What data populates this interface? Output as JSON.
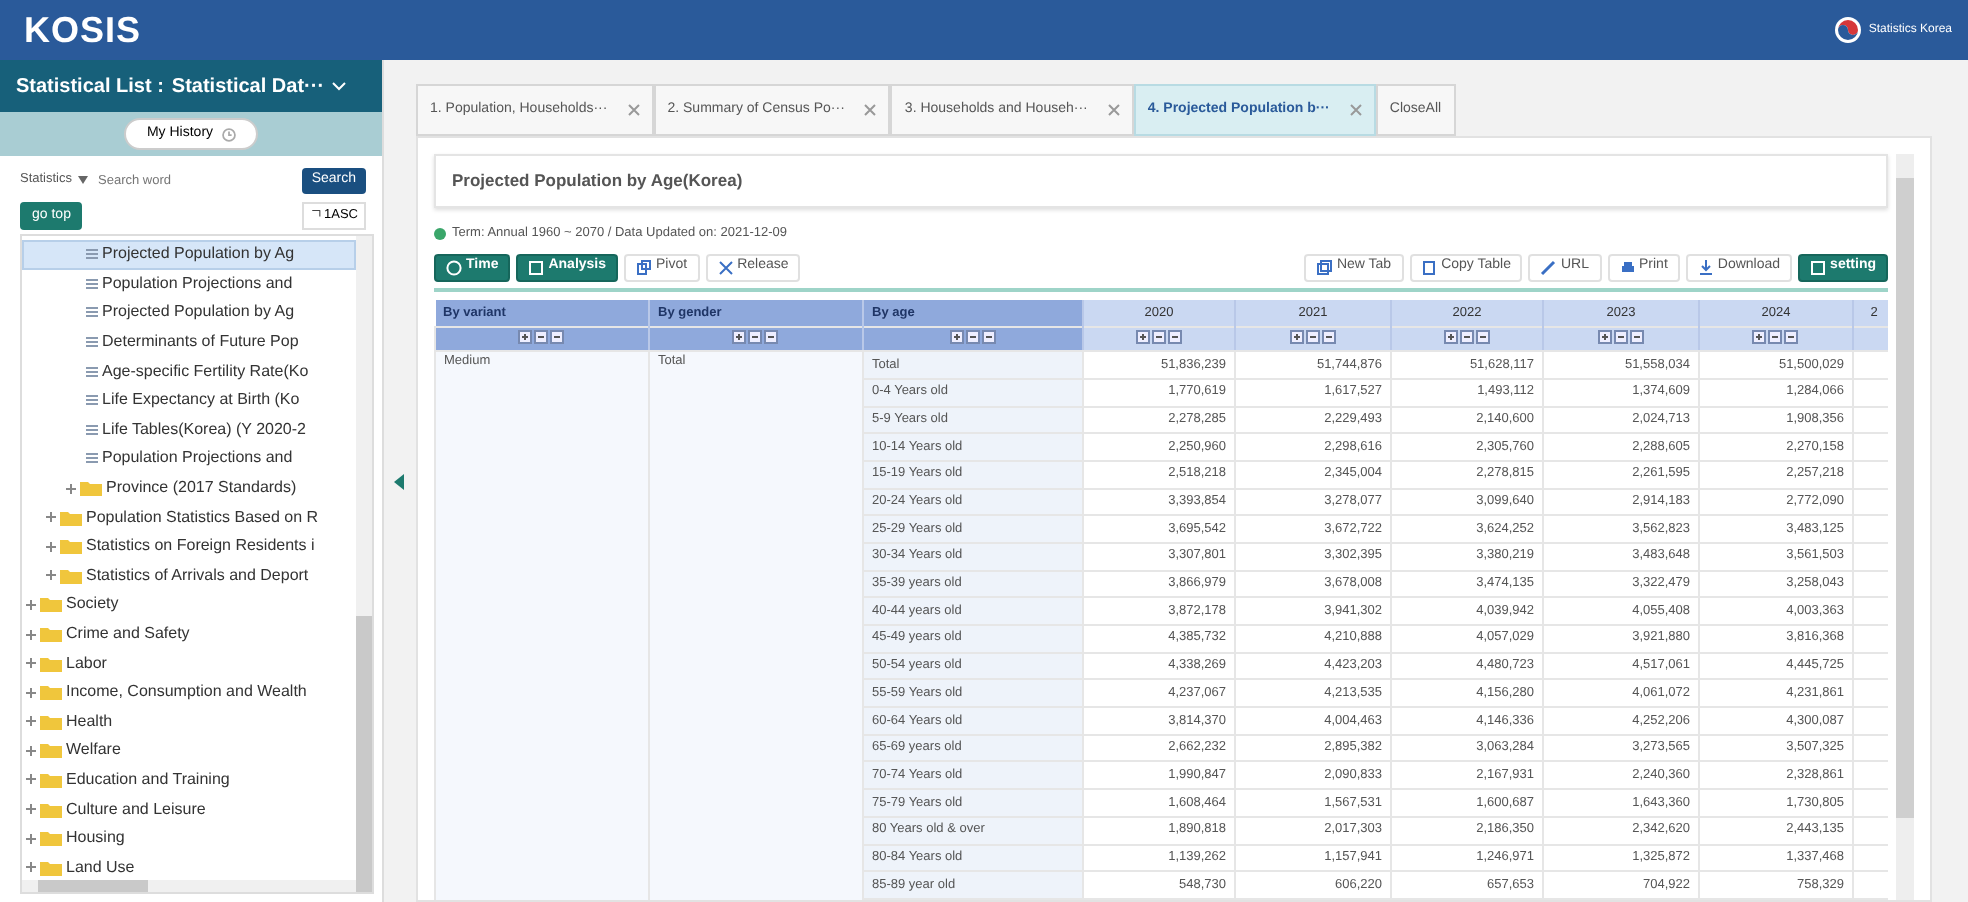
{
  "header": {
    "logo": "KOSIS",
    "org": "Statistics Korea"
  },
  "sidebar": {
    "list_title": "Statistical List :",
    "list_value": "Statistical Dat···",
    "history_button": "My History",
    "search_scope": "Statistics",
    "search_placeholder": "Search word",
    "search_button": "Search",
    "go_top_button": "go top",
    "sort_button": "ㄱ1ASC",
    "tree": [
      {
        "children": [
          {
            "children": [
              {
                "children": [
                  {
                    "label": "Projected Population by Ag",
                    "kind": "table",
                    "selected": true
                  },
                  {
                    "label": "Population Projections and",
                    "kind": "table",
                    "selected": false
                  },
                  {
                    "label": "Projected Population by Ag",
                    "kind": "table",
                    "selected": false
                  },
                  {
                    "label": "Determinants of Future Pop",
                    "kind": "table",
                    "selected": false
                  },
                  {
                    "label": "Age-specific Fertility Rate(Ko",
                    "kind": "table",
                    "selected": false
                  },
                  {
                    "label": "Life Expectancy at Birth (Ko",
                    "kind": "table",
                    "selected": false
                  },
                  {
                    "label": "Life Tables(Korea) (Y 2020-2",
                    "kind": "table",
                    "selected": false
                  },
                  {
                    "label": "Population Projections and",
                    "kind": "table",
                    "selected": false
                  }
                ]
              },
              {
                "label": "Province (2017 Standards)",
                "kind": "folder",
                "selected": false
              }
            ]
          },
          {
            "label": "Population Statistics Based on R",
            "kind": "folder",
            "selected": false
          },
          {
            "label": "Statistics on Foreign Residents i",
            "kind": "folder",
            "selected": false
          },
          {
            "label": "Statistics of Arrivals and Deport",
            "kind": "folder",
            "selected": false
          }
        ]
      },
      {
        "label": "Society",
        "kind": "folder",
        "selected": false
      },
      {
        "label": "Crime and Safety",
        "kind": "folder",
        "selected": false
      },
      {
        "label": "Labor",
        "kind": "folder",
        "selected": false
      },
      {
        "label": "Income, Consumption and Wealth",
        "kind": "folder",
        "selected": false
      },
      {
        "label": "Health",
        "kind": "folder",
        "selected": false
      },
      {
        "label": "Welfare",
        "kind": "folder",
        "selected": false
      },
      {
        "label": "Education and Training",
        "kind": "folder",
        "selected": false
      },
      {
        "label": "Culture and Leisure",
        "kind": "folder",
        "selected": false
      },
      {
        "label": "Housing",
        "kind": "folder",
        "selected": false
      },
      {
        "label": "Land Use",
        "kind": "folder",
        "selected": false
      }
    ]
  },
  "tabs": [
    {
      "label": "1. Population, Households···",
      "selected": false
    },
    {
      "label": "2. Summary of Census Po···",
      "selected": false
    },
    {
      "label": "3. Households and Househ···",
      "selected": false
    },
    {
      "label": "4. Projected Population b···",
      "selected": true
    }
  ],
  "close_all": "CloseAll",
  "page_title": "Projected Population by Age(Korea)",
  "term_info": "Term: Annual 1960 ~ 2070 / Data Updated on: 2021-12-09",
  "toolbar_left": [
    {
      "label": "Time",
      "kind": "primary"
    },
    {
      "label": "Analysis",
      "kind": "primary"
    },
    {
      "label": "Pivot",
      "kind": "plain"
    },
    {
      "label": "Release",
      "kind": "plain"
    }
  ],
  "toolbar_right": [
    {
      "label": "New Tab",
      "kind": "plain"
    },
    {
      "label": "Copy Table",
      "kind": "plain"
    },
    {
      "label": "URL",
      "kind": "plain"
    },
    {
      "label": "Print",
      "kind": "plain"
    },
    {
      "label": "Download",
      "kind": "plain"
    },
    {
      "label": "setting",
      "kind": "primary"
    }
  ],
  "table": {
    "dimension_columns": [
      "By variant",
      "By gender",
      "By age"
    ],
    "year_columns": [
      "2020",
      "2021",
      "2022",
      "2023",
      "2024",
      "2"
    ],
    "variant": "Medium",
    "gender": "Total",
    "rows": [
      {
        "age": "Total",
        "values": [
          "51,836,239",
          "51,744,876",
          "51,628,117",
          "51,558,034",
          "51,500,029"
        ]
      },
      {
        "age": "0-4 Years old",
        "values": [
          "1,770,619",
          "1,617,527",
          "1,493,112",
          "1,374,609",
          "1,284,066"
        ]
      },
      {
        "age": "5-9 Years old",
        "values": [
          "2,278,285",
          "2,229,493",
          "2,140,600",
          "2,024,713",
          "1,908,356"
        ]
      },
      {
        "age": "10-14 Years old",
        "values": [
          "2,250,960",
          "2,298,616",
          "2,305,760",
          "2,288,605",
          "2,270,158"
        ]
      },
      {
        "age": "15-19 Years old",
        "values": [
          "2,518,218",
          "2,345,004",
          "2,278,815",
          "2,261,595",
          "2,257,218"
        ]
      },
      {
        "age": "20-24 Years old",
        "values": [
          "3,393,854",
          "3,278,077",
          "3,099,640",
          "2,914,183",
          "2,772,090"
        ]
      },
      {
        "age": "25-29 Years old",
        "values": [
          "3,695,542",
          "3,672,722",
          "3,624,252",
          "3,562,823",
          "3,483,125"
        ]
      },
      {
        "age": "30-34 Years old",
        "values": [
          "3,307,801",
          "3,302,395",
          "3,380,219",
          "3,483,648",
          "3,561,503"
        ]
      },
      {
        "age": "35-39 years old",
        "values": [
          "3,866,979",
          "3,678,008",
          "3,474,135",
          "3,322,479",
          "3,258,043"
        ]
      },
      {
        "age": "40-44 years old",
        "values": [
          "3,872,178",
          "3,941,302",
          "4,039,942",
          "4,055,408",
          "4,003,363"
        ]
      },
      {
        "age": "45-49 years old",
        "values": [
          "4,385,732",
          "4,210,888",
          "4,057,029",
          "3,921,880",
          "3,816,368"
        ]
      },
      {
        "age": "50-54 years old",
        "values": [
          "4,338,269",
          "4,423,203",
          "4,480,723",
          "4,517,061",
          "4,445,725"
        ]
      },
      {
        "age": "55-59 Years old",
        "values": [
          "4,237,067",
          "4,213,535",
          "4,156,280",
          "4,061,072",
          "4,231,861"
        ]
      },
      {
        "age": "60-64 Years old",
        "values": [
          "3,814,370",
          "4,004,463",
          "4,146,336",
          "4,252,206",
          "4,300,087"
        ]
      },
      {
        "age": "65-69 years old",
        "values": [
          "2,662,232",
          "2,895,382",
          "3,063,284",
          "3,273,565",
          "3,507,325"
        ]
      },
      {
        "age": "70-74 Years old",
        "values": [
          "1,990,847",
          "2,090,833",
          "2,167,931",
          "2,240,360",
          "2,328,861"
        ]
      },
      {
        "age": "75-79 Years old",
        "values": [
          "1,608,464",
          "1,567,531",
          "1,600,687",
          "1,643,360",
          "1,730,805"
        ]
      },
      {
        "age": "80 Years old & over",
        "values": [
          "1,890,818",
          "2,017,303",
          "2,186,350",
          "2,342,620",
          "2,443,135"
        ]
      },
      {
        "age": "80-84 Years old",
        "values": [
          "1,139,262",
          "1,157,941",
          "1,246,971",
          "1,325,872",
          "1,337,468"
        ]
      },
      {
        "age": "85-89 year old",
        "values": [
          "548,730",
          "606,220",
          "657,653",
          "704,922",
          "758,329"
        ]
      }
    ]
  }
}
